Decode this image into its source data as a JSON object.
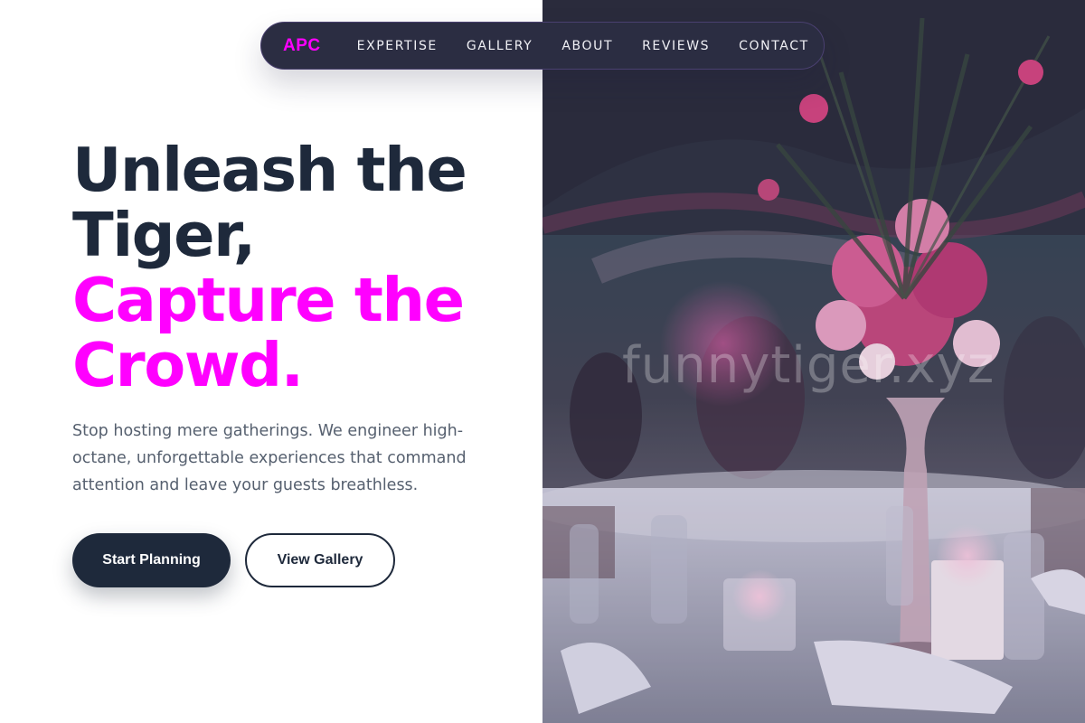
{
  "nav": {
    "logo": "APC",
    "links": [
      "EXPERTISE",
      "GALLERY",
      "ABOUT",
      "REVIEWS",
      "CONTACT"
    ]
  },
  "hero": {
    "headline_line1": "Unleash the",
    "headline_line2": "Tiger,",
    "headline_line3": "Capture the",
    "headline_line4": "Crowd.",
    "lead": "Stop hosting mere gatherings. We engineer high-octane, unforgettable experiences that command attention and leave your guests breathless.",
    "primary_cta": "Start Planning",
    "secondary_cta": "View Gallery"
  },
  "photo": {
    "watermark": "funnytiger.xyz"
  },
  "colors": {
    "accent": "#ff00ff",
    "dark": "#1e293b",
    "nav_bg": "#2b2d42",
    "body_text": "#56606f"
  }
}
